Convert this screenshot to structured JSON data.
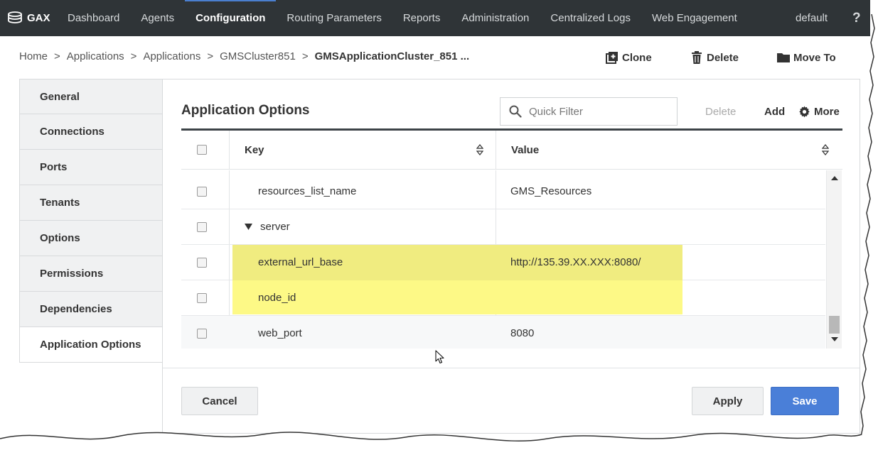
{
  "topnav": {
    "brand": "GAX",
    "items": [
      {
        "label": "Dashboard"
      },
      {
        "label": "Agents"
      },
      {
        "label": "Configuration"
      },
      {
        "label": "Routing Parameters"
      },
      {
        "label": "Reports"
      },
      {
        "label": "Administration"
      },
      {
        "label": "Centralized Logs"
      },
      {
        "label": "Web Engagement"
      }
    ],
    "active": "Configuration",
    "user": "default",
    "help": "?"
  },
  "breadcrumb": {
    "items": [
      "Home",
      "Applications",
      "Applications",
      "GMSCluster851"
    ],
    "current": "GMSApplicationCluster_851 ...",
    "separator": ">"
  },
  "toolbar": {
    "clone": "Clone",
    "delete": "Delete",
    "move_to": "Move To"
  },
  "sidetabs": [
    {
      "label": "General"
    },
    {
      "label": "Connections"
    },
    {
      "label": "Ports"
    },
    {
      "label": "Tenants"
    },
    {
      "label": "Options"
    },
    {
      "label": "Permissions"
    },
    {
      "label": "Dependencies"
    },
    {
      "label": "Application Options"
    }
  ],
  "active_tab": "Application Options",
  "panel": {
    "title": "Application Options",
    "quick_filter_placeholder": "Quick Filter",
    "delete_label": "Delete",
    "add_label": "Add",
    "more_label": "More"
  },
  "table": {
    "columns": {
      "key": "Key",
      "value": "Value"
    },
    "rows": [
      {
        "key": "resources_list_name",
        "value": "GMS_Resources"
      },
      {
        "key": "server",
        "value": "",
        "section": true,
        "expanded": true
      },
      {
        "key": "external_url_base",
        "value": "http://135.39.XX.XXX:8080/",
        "highlighted": true
      },
      {
        "key": "node_id",
        "value": "",
        "highlighted": true
      },
      {
        "key": "web_port",
        "value": "8080"
      }
    ]
  },
  "footer": {
    "cancel": "Cancel",
    "apply": "Apply",
    "save": "Save"
  },
  "colors": {
    "nav_bg": "#2f3437",
    "highlight": "#fdf986",
    "save_button": "#4a7fd8"
  }
}
